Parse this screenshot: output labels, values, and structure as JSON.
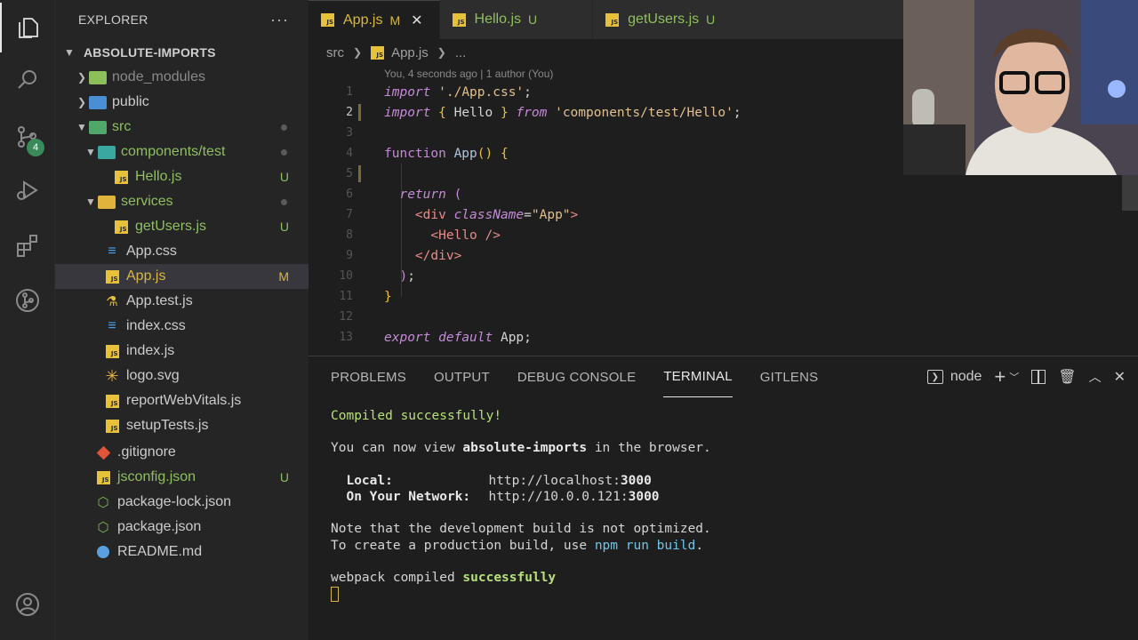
{
  "activity": {
    "scm_badge": "4"
  },
  "sidebar": {
    "title": "EXPLORER",
    "more": "···",
    "root": "ABSOLUTE-IMPORTS",
    "items": [
      {
        "label": "node_modules",
        "status": ""
      },
      {
        "label": "public",
        "status": ""
      },
      {
        "label": "src",
        "status": ""
      },
      {
        "label": "components/test",
        "status": ""
      },
      {
        "label": "Hello.js",
        "status": "U"
      },
      {
        "label": "services",
        "status": ""
      },
      {
        "label": "getUsers.js",
        "status": "U"
      },
      {
        "label": "App.css",
        "status": ""
      },
      {
        "label": "App.js",
        "status": "M"
      },
      {
        "label": "App.test.js",
        "status": ""
      },
      {
        "label": "index.css",
        "status": ""
      },
      {
        "label": "index.js",
        "status": ""
      },
      {
        "label": "logo.svg",
        "status": ""
      },
      {
        "label": "reportWebVitals.js",
        "status": ""
      },
      {
        "label": "setupTests.js",
        "status": ""
      },
      {
        "label": ".gitignore",
        "status": ""
      },
      {
        "label": "jsconfig.json",
        "status": "U"
      },
      {
        "label": "package-lock.json",
        "status": ""
      },
      {
        "label": "package.json",
        "status": ""
      },
      {
        "label": "README.md",
        "status": ""
      }
    ]
  },
  "editor": {
    "tabs": [
      {
        "name": "App.js",
        "status": "M",
        "close": "✕"
      },
      {
        "name": "Hello.js",
        "status": "U"
      },
      {
        "name": "getUsers.js",
        "status": "U"
      }
    ],
    "breadcrumb": {
      "folder": "src",
      "file": "App.js",
      "more": "..."
    },
    "blame": "You, 4 seconds ago | 1 author (You)",
    "line_numbers": [
      "1",
      "2",
      "3",
      "4",
      "5",
      "6",
      "7",
      "8",
      "9",
      "10",
      "11",
      "12",
      "13"
    ]
  },
  "panel": {
    "tabs": [
      "PROBLEMS",
      "OUTPUT",
      "DEBUG CONSOLE",
      "TERMINAL",
      "GITLENS"
    ],
    "terminal_name": "node",
    "terminal": {
      "compiled": "Compiled successfully!",
      "view_pre": "You can now view ",
      "app_name": "absolute-imports",
      "view_post": " in the browser.",
      "local_label": "Local:",
      "local_url_pre": "http://localhost:",
      "local_port": "3000",
      "network_label": "On Your Network:",
      "network_url_pre": "http://10.0.0.121:",
      "network_port": "3000",
      "note1": "Note that the development build is not optimized.",
      "note2_pre": "To create a production build, use ",
      "note2_cmd": "npm run build",
      "note2_post": ".",
      "webpack_pre": "webpack compiled ",
      "webpack_status": "successfully"
    }
  }
}
